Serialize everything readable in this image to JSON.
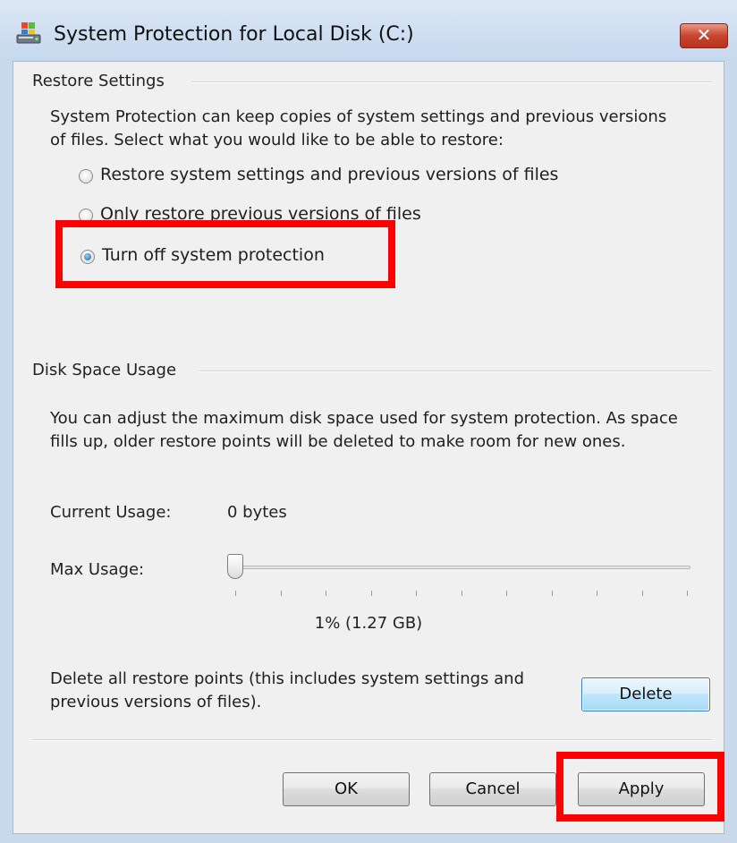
{
  "window": {
    "title": "System Protection for Local Disk (C:)",
    "close_label": "✕"
  },
  "restore_settings": {
    "group_label": "Restore Settings",
    "description": "System Protection can keep copies of system settings and previous versions of files. Select what you would like to be able to restore:",
    "options": [
      {
        "label": "Restore system settings and previous versions of files",
        "checked": false
      },
      {
        "label": "Only restore previous versions of files",
        "checked": false
      },
      {
        "label": "Turn off system protection",
        "checked": true
      }
    ]
  },
  "disk_space": {
    "group_label": "Disk Space Usage",
    "description": "You can adjust the maximum disk space used for system protection. As space fills up, older restore points will be deleted to make room for new ones.",
    "current_usage_label": "Current Usage:",
    "current_usage_value": "0 bytes",
    "max_usage_label": "Max Usage:",
    "max_usage_percent": 1,
    "max_usage_text": "1% (1.27 GB)",
    "delete_description": "Delete all restore points (this includes system settings and previous versions of files).",
    "delete_label": "Delete"
  },
  "buttons": {
    "ok": "OK",
    "cancel": "Cancel",
    "apply": "Apply"
  },
  "colors": {
    "highlight": "#ff0000",
    "radio_selected": "#1b5fa8",
    "title_gradient_top": "#dbe7f5"
  }
}
